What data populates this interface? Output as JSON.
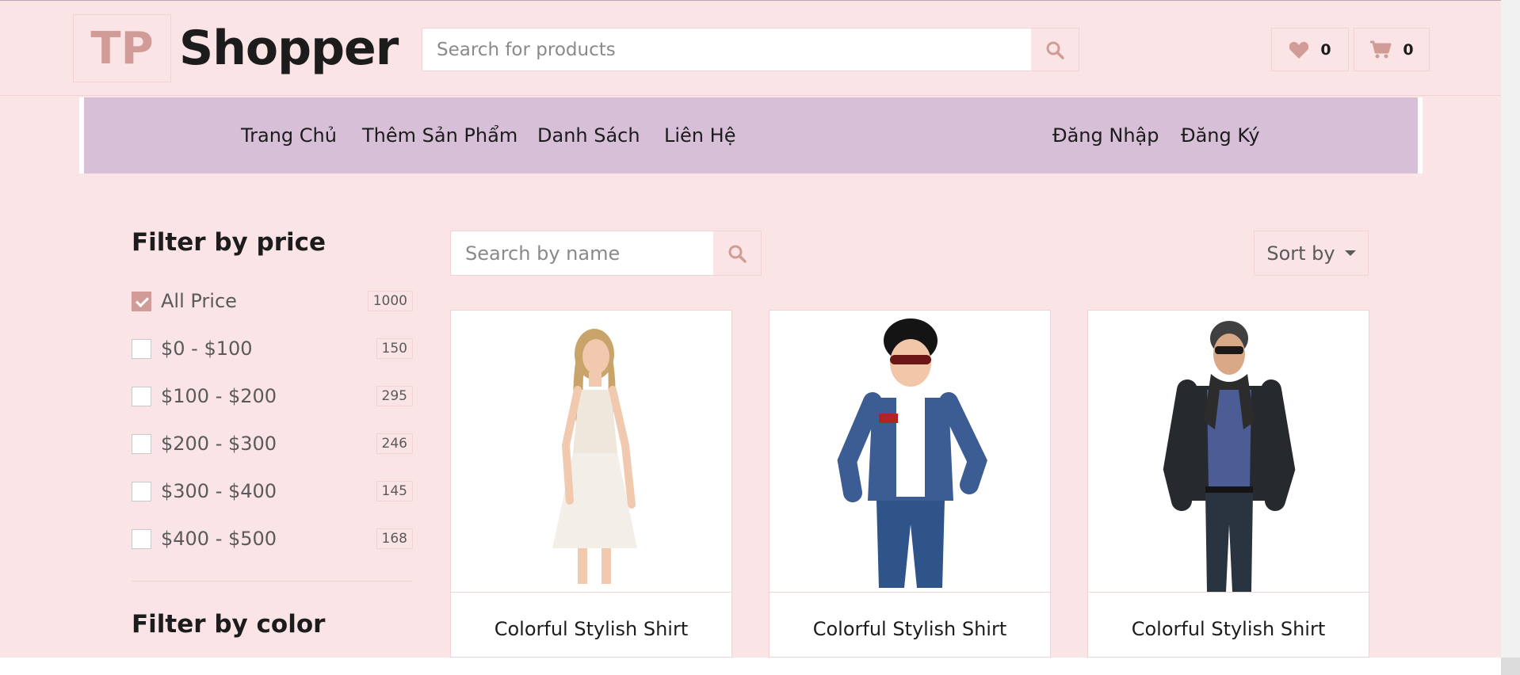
{
  "header": {
    "logo_mark": "TP",
    "logo_text": "Shopper",
    "search_placeholder": "Search for products",
    "wishlist_count": "0",
    "cart_count": "0"
  },
  "nav": {
    "left": [
      "Trang Chủ",
      "Thêm Sản Phẩm",
      "Danh Sách",
      "Liên Hệ"
    ],
    "right": [
      "Đăng Nhập",
      "Đăng Ký"
    ]
  },
  "sidebar": {
    "price_title": "Filter by price",
    "price_options": [
      {
        "label": "All Price",
        "count": "1000",
        "checked": true
      },
      {
        "label": "$0 - $100",
        "count": "150",
        "checked": false
      },
      {
        "label": "$100 - $200",
        "count": "295",
        "checked": false
      },
      {
        "label": "$200 - $300",
        "count": "246",
        "checked": false
      },
      {
        "label": "$300 - $400",
        "count": "145",
        "checked": false
      },
      {
        "label": "$400 - $500",
        "count": "168",
        "checked": false
      }
    ],
    "color_title": "Filter by color"
  },
  "toolbar": {
    "name_search_placeholder": "Search by name",
    "sort_label": "Sort by"
  },
  "products": [
    {
      "title": "Colorful Stylish Shirt"
    },
    {
      "title": "Colorful Stylish Shirt"
    },
    {
      "title": "Colorful Stylish Shirt"
    }
  ],
  "colors": {
    "accent": "#d19c97",
    "background": "#fbe4e5",
    "navbar": "#d8bfd8",
    "text": "#1c1c1c"
  }
}
